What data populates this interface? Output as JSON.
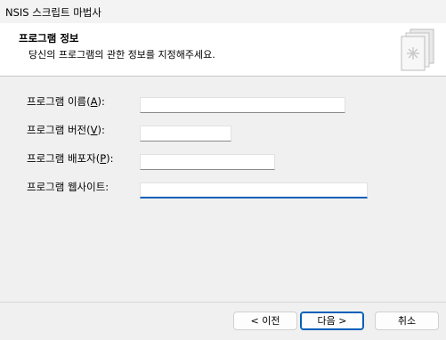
{
  "window": {
    "title": "NSIS 스크립트 마법사"
  },
  "header": {
    "title": "프로그램 정보",
    "subtitle": "당신의 프로그램의 관한 정보를 지정해주세요."
  },
  "form": {
    "name_label": "프로그램 이름(",
    "name_key": "A",
    "name_tail": "):",
    "name_value": "",
    "version_label": "프로그램 버전(",
    "version_key": "V",
    "version_tail": "):",
    "version_value": "",
    "publisher_label": "프로그램 배포자(",
    "publisher_key": "P",
    "publisher_tail": "):",
    "publisher_value": "",
    "website_label": "프로그램 웹사이트:",
    "website_value": ""
  },
  "buttons": {
    "back": "< 이전",
    "next": "다음 >",
    "cancel": "취소"
  },
  "colors": {
    "accent": "#005fb8",
    "background": "#f0f0f0",
    "header_background": "#ffffff"
  },
  "icons": {
    "wizard_logo": "book-pages-icon"
  }
}
